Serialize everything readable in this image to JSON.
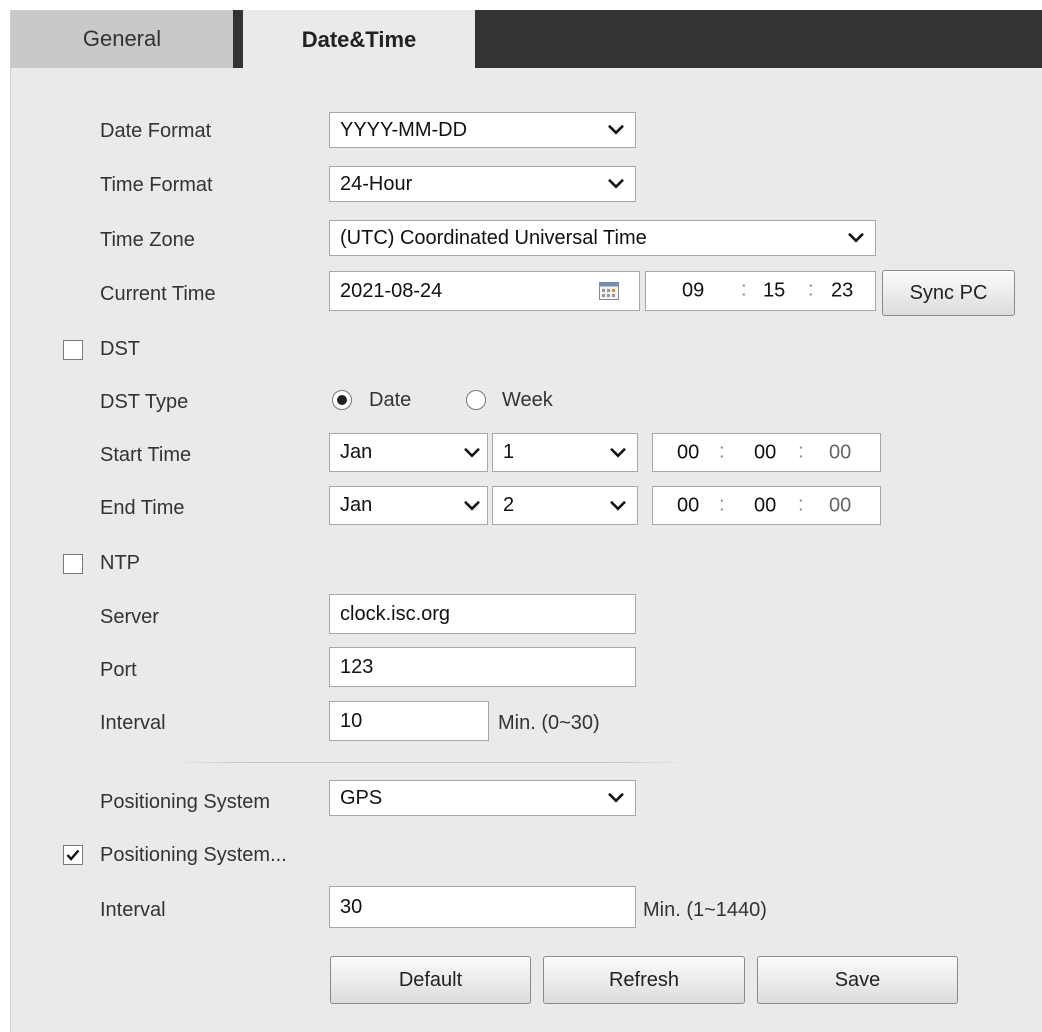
{
  "tabs": [
    {
      "label": "General",
      "active": false
    },
    {
      "label": "Date&Time",
      "active": true
    }
  ],
  "form": {
    "date_format": {
      "label": "Date Format",
      "value": "YYYY-MM-DD"
    },
    "time_format": {
      "label": "Time Format",
      "value": "24-Hour"
    },
    "time_zone": {
      "label": "Time Zone",
      "value": "(UTC) Coordinated Universal Time"
    },
    "current_time": {
      "label": "Current Time",
      "date": "2021-08-24",
      "hh": "09",
      "mm": "15",
      "ss": "23",
      "sync_label": "Sync PC"
    },
    "dst": {
      "label": "DST",
      "checked": false
    },
    "dst_type": {
      "label": "DST Type",
      "options": [
        "Date",
        "Week"
      ],
      "selected": "Date"
    },
    "start_time": {
      "label": "Start Time",
      "month": "Jan",
      "day": "1",
      "hh": "00",
      "mm": "00",
      "ss": "00"
    },
    "end_time": {
      "label": "End Time",
      "month": "Jan",
      "day": "2",
      "hh": "00",
      "mm": "00",
      "ss": "00"
    },
    "ntp": {
      "label": "NTP",
      "checked": false
    },
    "server": {
      "label": "Server",
      "value": "clock.isc.org"
    },
    "port": {
      "label": "Port",
      "value": "123"
    },
    "ntp_interval": {
      "label": "Interval",
      "value": "10",
      "unit": "Min. (0~30)"
    },
    "positioning_system": {
      "label": "Positioning System",
      "value": "GPS"
    },
    "positioning_enable": {
      "label": "Positioning System...",
      "checked": true
    },
    "pos_interval": {
      "label": "Interval",
      "value": "30",
      "unit": "Min. (1~1440)"
    },
    "time_separator": ":"
  },
  "buttons": {
    "default_label": "Default",
    "refresh_label": "Refresh",
    "save_label": "Save"
  },
  "colors": {
    "tabbar_bg": "#333333",
    "panel_bg": "#eaeaea",
    "inactive_tab": "#c9c9c9"
  }
}
